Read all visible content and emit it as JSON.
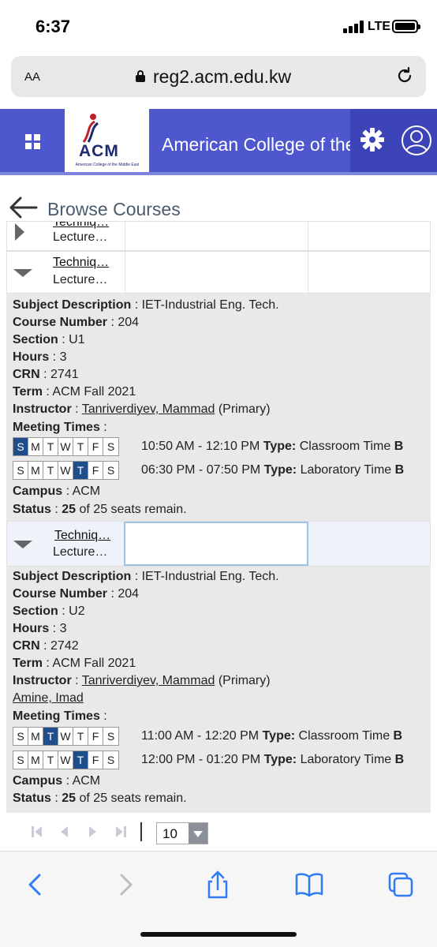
{
  "status_bar": {
    "time": "6:37",
    "network": "LTE"
  },
  "browser": {
    "text_size_label": "AA",
    "url": "reg2.acm.edu.kw"
  },
  "header": {
    "logo_text": "ACM",
    "logo_subtitle": "American College of the Middle East",
    "title": "American College of the Middle East",
    "brand_color": "#4f57cf"
  },
  "page": {
    "heading": "Browse Courses"
  },
  "rows": [
    {
      "title": "Techniq…",
      "subtitle": "Lecture…"
    },
    {
      "title": "Techniq…",
      "subtitle": "Lecture…"
    },
    {
      "title": "Techniq…",
      "subtitle": "Lecture…"
    }
  ],
  "sections": [
    {
      "subject_label": "Subject Description",
      "subject": "IET-Industrial Eng. Tech.",
      "course_number_label": "Course Number",
      "course_number": "204",
      "section_label": "Section",
      "section": "U1",
      "hours_label": "Hours",
      "hours": "3",
      "crn_label": "CRN",
      "crn": "2741",
      "term_label": "Term",
      "term": "ACM Fall 2021",
      "instructor_label": "Instructor",
      "instructor": "Tanriverdiyev, Mammad",
      "instructor_role": "(Primary)",
      "meeting_label": "Meeting Times",
      "meetings": [
        {
          "days": [
            "S",
            "M",
            "T",
            "W",
            "T",
            "F",
            "S"
          ],
          "active": [
            0
          ],
          "time": "10:50 AM - 12:10 PM",
          "type_label": "Type:",
          "type": "Classroom Time",
          "overflow": "B"
        },
        {
          "days": [
            "S",
            "M",
            "T",
            "W",
            "T",
            "F",
            "S"
          ],
          "active": [
            4
          ],
          "time": "06:30 PM - 07:50 PM",
          "type_label": "Type:",
          "type": "Laboratory Time",
          "overflow": "B"
        }
      ],
      "campus_label": "Campus",
      "campus": "ACM",
      "status_label": "Status",
      "seats": "25",
      "status_text": "of 25 seats remain."
    },
    {
      "subject_label": "Subject Description",
      "subject": "IET-Industrial Eng. Tech.",
      "course_number_label": "Course Number",
      "course_number": "204",
      "section_label": "Section",
      "section": "U2",
      "hours_label": "Hours",
      "hours": "3",
      "crn_label": "CRN",
      "crn": "2742",
      "term_label": "Term",
      "term": "ACM Fall 2021",
      "instructor_label": "Instructor",
      "instructor": "Tanriverdiyev, Mammad",
      "instructor_role": "(Primary)",
      "instructor2": "Amine, Imad",
      "meeting_label": "Meeting Times",
      "meetings": [
        {
          "days": [
            "S",
            "M",
            "T",
            "W",
            "T",
            "F",
            "S"
          ],
          "active": [
            2
          ],
          "time": "11:00 AM - 12:20 PM",
          "type_label": "Type:",
          "type": "Classroom Time",
          "overflow": "B"
        },
        {
          "days": [
            "S",
            "M",
            "T",
            "W",
            "T",
            "F",
            "S"
          ],
          "active": [
            4
          ],
          "time": "12:00 PM - 01:20 PM",
          "type_label": "Type:",
          "type": "Laboratory Time",
          "overflow": "B"
        }
      ],
      "campus_label": "Campus",
      "campus": "ACM",
      "status_label": "Status",
      "seats": "25",
      "status_text": "of 25 seats remain."
    }
  ],
  "pager": {
    "page_size": "10"
  }
}
